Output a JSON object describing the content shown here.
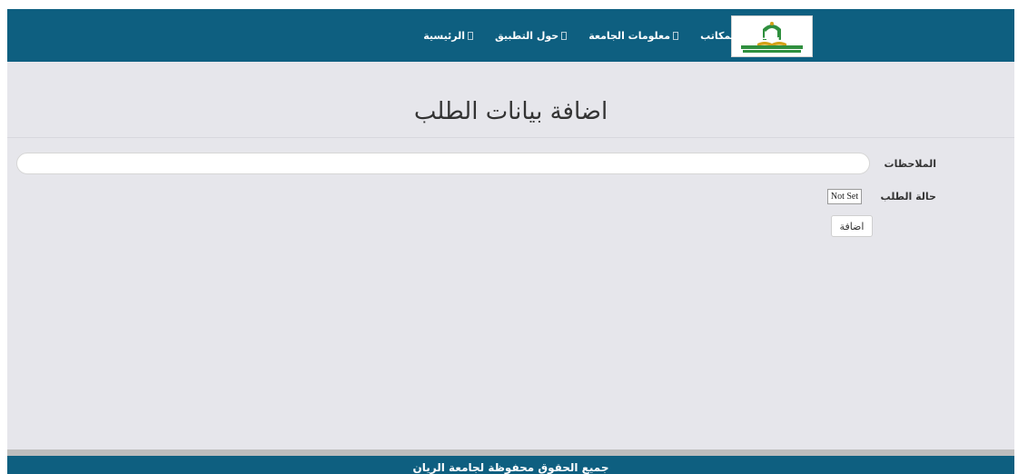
{
  "nav": {
    "items": [
      {
        "label": "الرئيسية",
        "icon": "box-icon"
      },
      {
        "label": "حول التطبيق",
        "icon": "box-icon"
      },
      {
        "label": "معلومات الجامعة",
        "icon": "box-icon"
      },
      {
        "label": "عرض طلبات المكاتب",
        "icon": "box-icon"
      }
    ],
    "logo_icon": "university-logo"
  },
  "page": {
    "title": "اضافة بيانات الطلب"
  },
  "form": {
    "notes_label": "الملاحظات",
    "notes_value": "",
    "status_label": "حالة الطلب",
    "status_value": "Not Set",
    "submit_label": "اضافة"
  },
  "footer": {
    "text": "جميع الحقوق محفوظة لجامعة الريان"
  },
  "colors": {
    "navbar": "#0e5f80",
    "page_background": "#e6e6eb",
    "footer": "#0e5f80"
  }
}
